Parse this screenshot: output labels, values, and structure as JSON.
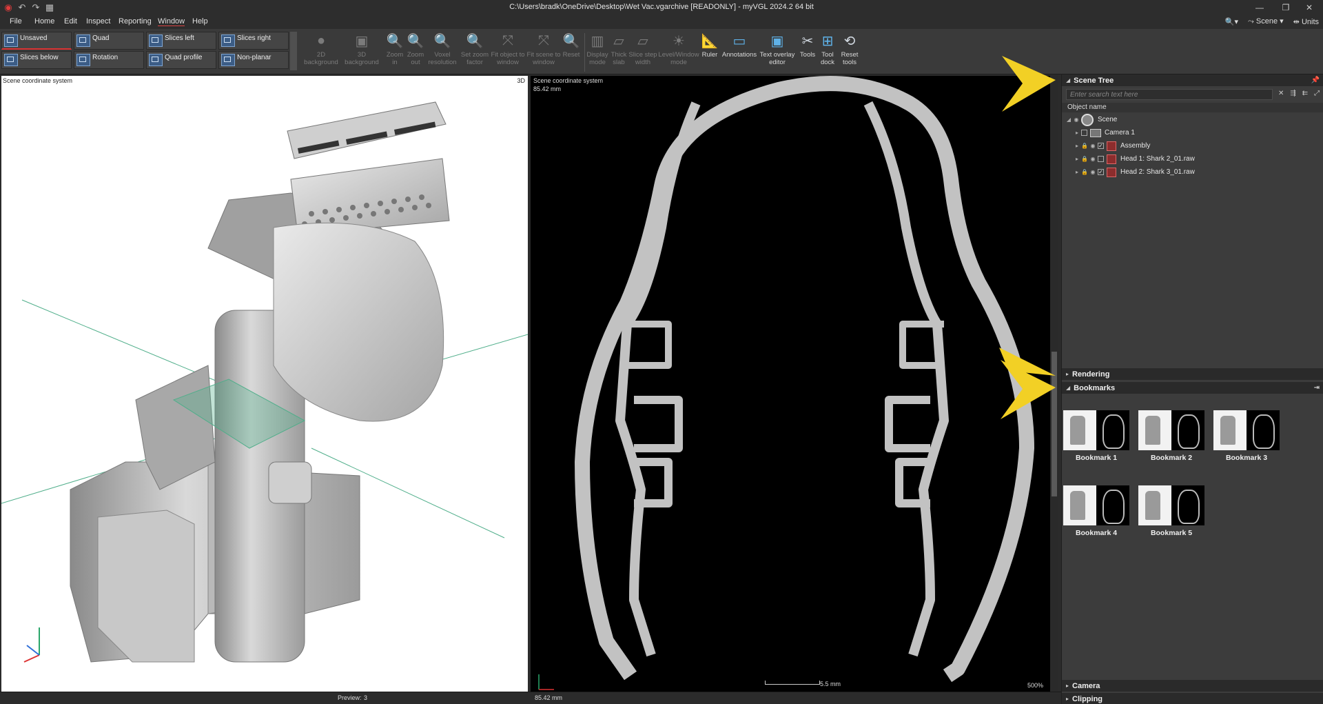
{
  "window": {
    "title": "C:\\Users\\bradk\\OneDrive\\Desktop\\Wet Vac.vgarchive [READONLY] - myVGL 2024.2 64 bit",
    "minimize_icon": "minimize-icon",
    "restore_icon": "restore-icon",
    "close_icon": "close-icon"
  },
  "menu": {
    "items": [
      "File",
      "Home",
      "Edit",
      "Inspect",
      "Reporting",
      "Window",
      "Help"
    ],
    "active": "Window",
    "right": {
      "scene": "Scene",
      "units": "Units"
    }
  },
  "ribbon": {
    "layouts": [
      "Unsaved",
      "Quad",
      "Slices left",
      "Slices right",
      "Slices below",
      "Rotation",
      "Quad profile",
      "Non-planar"
    ],
    "tools": [
      {
        "label": "2D background",
        "icon": "background-2d-icon",
        "enabled": false
      },
      {
        "label": "3D background",
        "icon": "background-3d-icon",
        "enabled": false
      },
      {
        "label": "Zoom in",
        "icon": "zoom-in-icon",
        "enabled": false
      },
      {
        "label": "Zoom out",
        "icon": "zoom-out-icon",
        "enabled": false
      },
      {
        "label": "Voxel resolution",
        "icon": "voxel-resolution-icon",
        "enabled": false
      },
      {
        "label": "Set zoom factor",
        "icon": "zoom-factor-icon",
        "enabled": false
      },
      {
        "label": "Fit object to window",
        "icon": "fit-object-icon",
        "enabled": false
      },
      {
        "label": "Fit scene to window",
        "icon": "fit-scene-icon",
        "enabled": false
      },
      {
        "label": "Reset",
        "icon": "reset-zoom-icon",
        "enabled": false
      },
      {
        "label": "Display mode",
        "icon": "display-mode-icon",
        "enabled": false
      },
      {
        "label": "Thick slab",
        "icon": "thick-slab-icon",
        "enabled": false
      },
      {
        "label": "Slice step width",
        "icon": "slice-step-icon",
        "enabled": false
      },
      {
        "label": "Level/Window mode",
        "icon": "level-window-icon",
        "enabled": false
      },
      {
        "label": "Ruler",
        "icon": "ruler-icon",
        "enabled": true
      },
      {
        "label": "Annotations",
        "icon": "annotations-icon",
        "enabled": true
      },
      {
        "label": "Text overlay editor",
        "icon": "text-overlay-icon",
        "enabled": true
      },
      {
        "label": "Tools",
        "icon": "tools-icon",
        "enabled": true
      },
      {
        "label": "Tool dock",
        "icon": "tool-dock-icon",
        "enabled": true
      },
      {
        "label": "Reset tools",
        "icon": "reset-tools-icon",
        "enabled": true
      }
    ]
  },
  "viewport3d": {
    "title": "Scene coordinate system",
    "tag": "3D"
  },
  "viewport2d": {
    "title": "Scene coordinate system",
    "distance": "85.42 mm",
    "scale": "5.5 mm",
    "zoom": "500%"
  },
  "status": {
    "preview_label": "Preview:",
    "preview_value": "3",
    "distance": "85.42 mm"
  },
  "scene_tree": {
    "header": "Scene Tree",
    "search_placeholder": "Enter search text here",
    "column": "Object name",
    "items": [
      {
        "label": "Scene",
        "level": 0,
        "type": "scene"
      },
      {
        "label": "Camera 1",
        "level": 1,
        "type": "camera",
        "checked": false
      },
      {
        "label": "Assembly",
        "level": 1,
        "type": "volume",
        "checked": true
      },
      {
        "label": "Head 1: Shark 2_01.raw",
        "level": 1,
        "type": "volume",
        "checked": false
      },
      {
        "label": "Head 2: Shark 3_01.raw",
        "level": 1,
        "type": "volume",
        "checked": true
      }
    ]
  },
  "sections": {
    "rendering": "Rendering",
    "bookmarks": "Bookmarks",
    "camera": "Camera",
    "clipping": "Clipping"
  },
  "bookmarks": [
    "Bookmark 1",
    "Bookmark 2",
    "Bookmark 3",
    "Bookmark 4",
    "Bookmark 5"
  ],
  "colors": {
    "accent_arrow": "#f2d025",
    "volume_icon": "#8c2d2d",
    "plane_green": "#4fae8a"
  }
}
